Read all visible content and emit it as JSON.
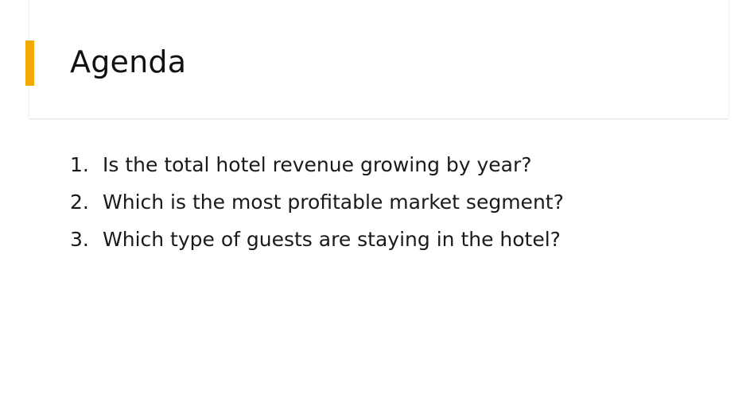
{
  "slide": {
    "title": "Agenda",
    "accent_color": "#f2a900",
    "items": [
      {
        "number": "1.",
        "text": "Is the total hotel revenue growing by year?"
      },
      {
        "number": "2.",
        "text": "Which is the most profitable market segment?"
      },
      {
        "number": "3.",
        "text": "Which type of guests are staying in the hotel?"
      }
    ]
  }
}
